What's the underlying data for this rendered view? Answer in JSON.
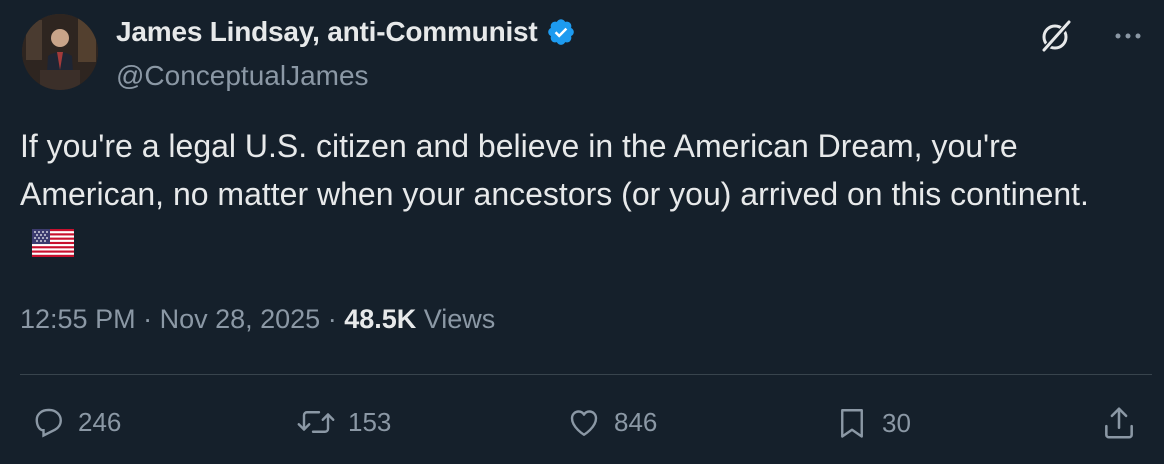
{
  "author": {
    "display_name": "James Lindsay, anti-Communist",
    "handle": "@ConceptualJames",
    "verified_icon": "verified-badge-icon"
  },
  "tweet": {
    "text": "If you're a legal U.S. citizen and believe in the American Dream, you're American, no matter when your ancestors (or you) arrived on this continent.",
    "emoji": "us-flag-emoji"
  },
  "meta": {
    "time": "12:55 PM",
    "sep1": " · ",
    "date": "Nov 28, 2025",
    "sep2": " · ",
    "views_count": "48.5K",
    "views_label": " Views"
  },
  "actions": {
    "replies": "246",
    "reposts": "153",
    "likes": "846",
    "bookmarks": "30"
  },
  "colors": {
    "background": "#15202b",
    "text": "#e7e9ea",
    "secondary": "#8b98a5",
    "divider": "#38444d",
    "verified": "#1d9bf0"
  }
}
